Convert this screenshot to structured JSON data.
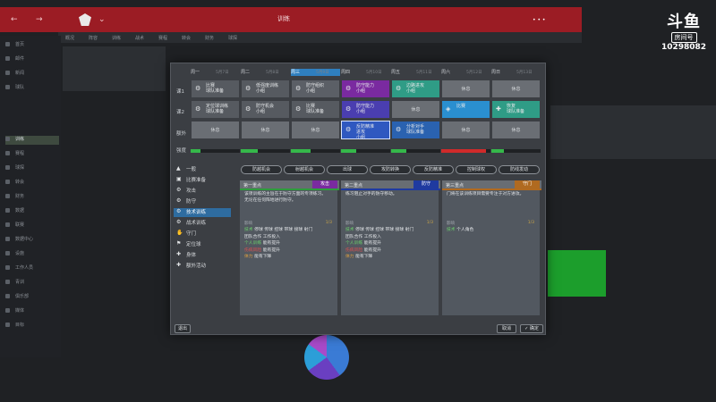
{
  "top": {
    "title": "训练",
    "watermark_logo": "斗鱼",
    "watermark_room": "房间号",
    "watermark_number": "10298082"
  },
  "subnav": [
    "概况",
    "阵容",
    "训练",
    "战术",
    "赛程",
    "转会",
    "财务",
    "球探"
  ],
  "sidebar": [
    "首页",
    "邮件",
    "新闻",
    "球队",
    "训练",
    "赛程",
    "球探",
    "转会",
    "财务",
    "数据",
    "联赛",
    "数据中心",
    "设施",
    "工作人员",
    "青训",
    "俱乐部",
    "媒体",
    "目标"
  ],
  "days": [
    {
      "name": "周一",
      "date": "5月7日"
    },
    {
      "name": "周二",
      "date": "5月8日"
    },
    {
      "name": "周三",
      "date": "5月9日"
    },
    {
      "name": "周四",
      "date": "5月10日"
    },
    {
      "name": "周五",
      "date": "5月11日"
    },
    {
      "name": "周六",
      "date": "5月12日"
    },
    {
      "name": "周日",
      "date": "5月13日"
    }
  ],
  "row_labels": [
    "课1",
    "课2",
    "额外",
    "强度"
  ],
  "schedule": [
    [
      "比赛\n球队准备",
      "低强度训练\n小组",
      "防守组织\n小组",
      "防守能力\n小组",
      "边路进攻\n小组",
      "休息",
      "休息"
    ],
    [
      "定位球训练\n球队准备",
      "防守机会\n小组",
      "比赛\n球队准备",
      "防守能力\n小组",
      "休息",
      "比赛",
      "恢复\n球队准备"
    ],
    [
      "休息",
      "休息",
      "休息",
      "反防精准\n进攻\n小组",
      "分析对手\n球队准备",
      "休息",
      "休息"
    ]
  ],
  "categories": [
    "一般",
    "比赛准备",
    "攻击",
    "防守",
    "技术训练",
    "战术训练",
    "守门",
    "定位球",
    "身体",
    "额外活动"
  ],
  "drills": [
    "防越机会",
    "射越机会",
    "出球",
    "攻防转换",
    "反防精准",
    "控制球权",
    "防线发动"
  ],
  "panels": [
    {
      "head": "第一重点",
      "tag": "攻击",
      "desc": "该项训练的主旨在于防守方面的专项练习。\n无论在任何阵地进行防守。",
      "sub_left": "影响",
      "sub_right": "1/3",
      "attrs": [
        {
          "k": "技术",
          "v": "停球 传球 控球 带球 接球 射门"
        },
        {
          "k": "团队合作",
          "v": "工作投入"
        },
        {
          "k": "个人训练",
          "v": "能有提升"
        },
        {
          "k": "伤病风险",
          "v": "能有提升"
        },
        {
          "k": "体力",
          "v": "能有下降"
        }
      ]
    },
    {
      "head": "第二重点",
      "tag": "防守",
      "desc": "练习阻止对手的防守移动。",
      "sub_left": "影响",
      "sub_right": "1/3",
      "attrs": [
        {
          "k": "技术",
          "v": "停球 传球 控球 带球 接球 射门"
        },
        {
          "k": "团队合作",
          "v": "工作投入"
        },
        {
          "k": "个人训练",
          "v": "能有提升"
        },
        {
          "k": "伤病风险",
          "v": "能有提升"
        },
        {
          "k": "体力",
          "v": "能有下降"
        }
      ]
    },
    {
      "head": "第三重点",
      "tag": "守门",
      "desc": "门将在该训练项目需要专注于对方进攻。",
      "sub_left": "影响",
      "sub_right": "1/3",
      "attrs": [
        {
          "k": "技术",
          "v": "个人角色"
        }
      ]
    }
  ],
  "footer": {
    "left": "退出",
    "cancel": "取消",
    "confirm": "✓ 确定"
  },
  "intensity": [
    0.2,
    0.35,
    0.4,
    0.3,
    0.3,
    0.9,
    0.25
  ],
  "colors": {
    "accent": "#9b1c24",
    "selected": "#2f58c0",
    "purple": "#7a2aa0",
    "green": "#2f9c86"
  }
}
